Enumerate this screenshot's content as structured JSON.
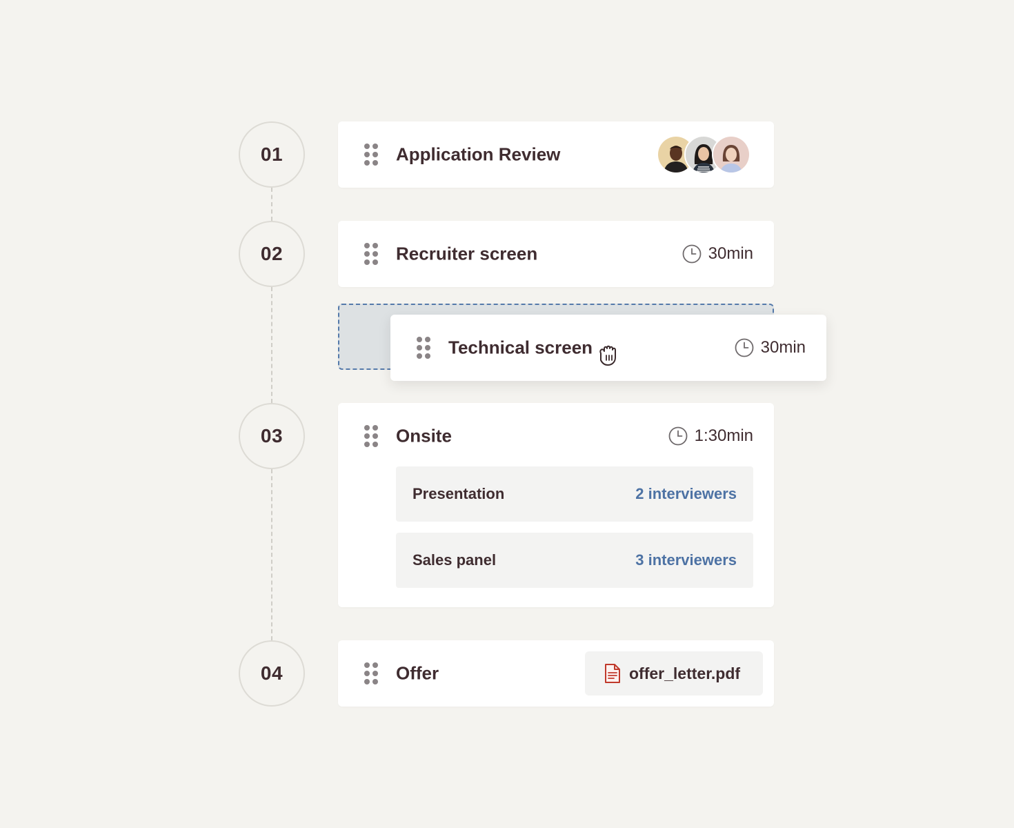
{
  "steps": [
    {
      "number": "01",
      "title": "Application Review",
      "avatars": [
        "avatar-person-1",
        "avatar-person-2",
        "avatar-person-3"
      ]
    },
    {
      "number": "02",
      "title": "Recruiter screen",
      "duration": "30min"
    },
    {
      "number": "03",
      "title": "Onsite",
      "duration": "1:30min",
      "sessions": [
        {
          "label": "Presentation",
          "interviewers": "2 interviewers"
        },
        {
          "label": "Sales panel",
          "interviewers": "3 interviewers"
        }
      ]
    },
    {
      "number": "04",
      "title": "Offer",
      "attachment": {
        "name": "offer_letter.pdf",
        "icon": "pdf-file-icon"
      }
    }
  ],
  "dragging": {
    "title": "Technical screen",
    "duration": "30min",
    "cursor": "grab-cursor-icon"
  },
  "colors": {
    "background": "#f4f3ef",
    "accent": "#4d72a4",
    "text": "#3f2c30",
    "pdf_icon": "#c0392b"
  }
}
